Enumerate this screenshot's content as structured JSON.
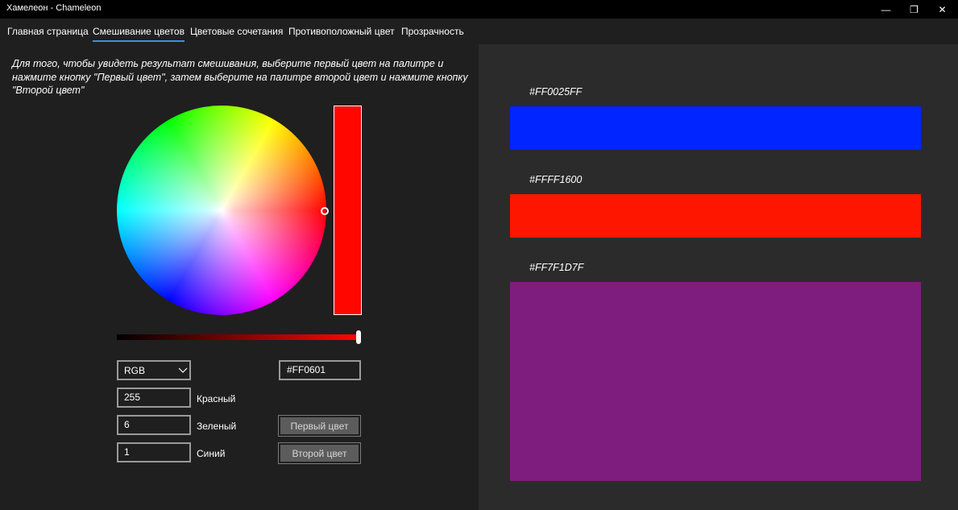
{
  "window": {
    "title": "Хамелеон - Chameleon",
    "minimize_icon": "—",
    "restore_icon": "❐",
    "close_icon": "✕"
  },
  "tabs": [
    {
      "label": "Главная страница",
      "active": false
    },
    {
      "label": "Смешивание цветов",
      "active": true
    },
    {
      "label": "Цветовые сочетания",
      "active": false
    },
    {
      "label": "Противоположный цвет",
      "active": false
    },
    {
      "label": "Прозрачность",
      "active": false
    }
  ],
  "mixer": {
    "instructions": "Для того, чтобы увидеть результат смешивания, выберите первый цвет на палитре и нажмите кнопку \"Первый цвет\", затем выберите на палитре второй цвет и нажмите кнопку \"Второй цвет\"",
    "selected_color": "#ff0601",
    "brightness_level": 1.0,
    "mode": "RGB",
    "hex": "#FF0601",
    "red": {
      "value": "255",
      "label": "Красный"
    },
    "green": {
      "value": "6",
      "label": "Зеленый"
    },
    "blue": {
      "value": "1",
      "label": "Синий"
    },
    "first_button": "Первый цвет",
    "second_button": "Второй цвет"
  },
  "results": {
    "first": {
      "hex": "#FF0025FF",
      "color": "#0025ff"
    },
    "second": {
      "hex": "#FFFF1600",
      "color": "#ff1600"
    },
    "mix": {
      "hex": "#FF7F1D7F",
      "color": "#7f1d7f"
    }
  }
}
